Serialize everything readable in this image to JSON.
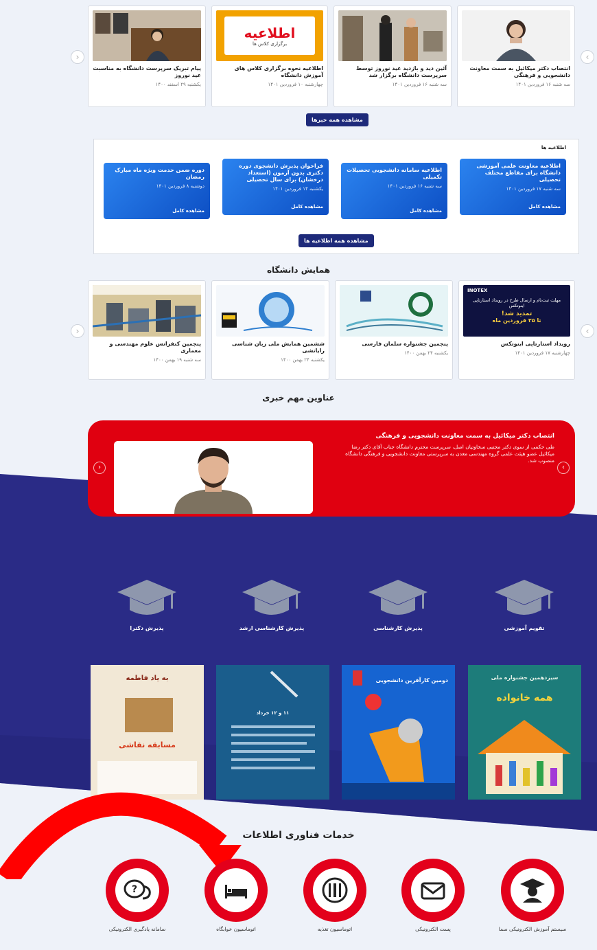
{
  "news": [
    {
      "title": "انتصاب دکتر میکائیل به سمت معاونت دانشجویی و فرهنگی",
      "date": "سه شنبه ۱۶ فروردین ۱۴۰۱"
    },
    {
      "title": "آئین دید و بازدید عید نوروز توسط سرپرست دانشگاه برگزار شد",
      "date": "سه شنبه ۱۶ فروردین ۱۴۰۱"
    },
    {
      "title": "اطلاعیه نحوه برگزاری کلاس های آموزش دانشگاه",
      "date": "چهارشنبه ۱۰ فروردین ۱۴۰۱",
      "thumb_heading": "اطلاعیه",
      "thumb_sub": "برگزاری کلاس ها"
    },
    {
      "title": "پیام تبریک سرپرست دانشگاه به مناسبت عید نوروز",
      "date": "یکشنبه ۲۹ اسفند ۱۴۰۰"
    }
  ],
  "news_button": "مشاهده همه خبرها",
  "notices_heading": "اطلاعیه ها",
  "notices": [
    {
      "title": "اطلاعیه معاونت علمی آموزشی دانشگاه برای مقاطع مختلف تحصیلی",
      "date": "سه شنبه ۱۷ فروردین ۱۴۰۱",
      "more": "مشاهده کامل"
    },
    {
      "title": "اطلاعیه سامانه دانشجویی تحصیلات تکمیلی",
      "date": "سه شنبه ۱۶ فروردین ۱۴۰۱",
      "more": "مشاهده کامل"
    },
    {
      "title": "فراخوان پذیرش دانشجوی دوره دکتری بدون آزمون (استعداد درخشان) برای سال تحصیلی",
      "date": "یکشنبه ۱۴ فروردین ۱۴۰۱",
      "more": "مشاهده کامل"
    },
    {
      "title": "دوره ضمن خدمت ویژه ماه مبارک رمضان",
      "date": "دوشنبه ۸ فروردین ۱۴۰۱",
      "more": "مشاهده کامل"
    }
  ],
  "notices_button": "مشاهده همه اطلاعیه ها",
  "conf_heading": "همایش دانشگاه",
  "conferences": [
    {
      "title": "رویداد استارتاپی اینوتکس",
      "date": "چهارشنبه ۱۷ فروردین ۱۴۰۱",
      "thumb_brand": "INOTEX",
      "thumb_text": "مهلت ثبت‌نام و ارسال طرح در رویداد استارتاپی اینوتکس",
      "thumb_badge": "تمدید شد!",
      "thumb_deadline": "تا ۲۵ فروردین ماه"
    },
    {
      "title": "پنجمین جشنواره سلمان فارسی",
      "date": "یکشنبه ۲۴ بهمن ۱۴۰۰"
    },
    {
      "title": "ششمین همایش ملی زبان شناسی رایانشی",
      "date": "یکشنبه ۲۴ بهمن ۱۴۰۰"
    },
    {
      "title": "پنجمین کنفرانس علوم مهندسی و معماری",
      "date": "سه شنبه ۱۹ بهمن ۱۴۰۰"
    }
  ],
  "headlines_heading": "عناوین مهم خبری",
  "hero": {
    "title": "انتصاب دکتر میکائیل به سمت معاونت دانشجویی و فرهنگی",
    "text": "طی حکمی از سوی دکتر مجتبی سخاوتیان اصل، سرپرست محترم دانشگاه جناب آقای دکتر رضا میکائیل عضو هیئت علمی گروه مهندسی معدن به سرپرستی معاونت دانشجویی و فرهنگی دانشگاه منصوب شد."
  },
  "capabilities": [
    "تقویم آموزشی",
    "پذیرش کارشناسی",
    "پذیرش کارشناسی ارشد",
    "پذیرش دکترا"
  ],
  "posters": [
    {
      "headline": "سیزدهمین جشنواره ملی",
      "title": "همه خانواده"
    },
    {
      "headline": "دومین کارآفرین دانشجویی"
    },
    {
      "headline": "۱۱ و ۱۲ خرداد"
    },
    {
      "headline": "به یاد فاطمه",
      "title": "مسابقه نقاشی"
    }
  ],
  "services_heading": "خدمات فناوری اطلاعات",
  "services": [
    {
      "label": "سیستم آموزش الکترونیکی سما",
      "icon": "student-icon"
    },
    {
      "label": "پست الکترونیکی",
      "icon": "mail-icon"
    },
    {
      "label": "اتوماسیون تغذیه",
      "icon": "food-icon"
    },
    {
      "label": "اتوماسیون خوابگاه",
      "icon": "bed-icon"
    },
    {
      "label": "سامانه یادگیری الکترونیکی",
      "icon": "question-chat-icon"
    }
  ],
  "colors": {
    "navy": "#2a2b86",
    "red": "#e3001b",
    "blue": "#1a66e0"
  }
}
